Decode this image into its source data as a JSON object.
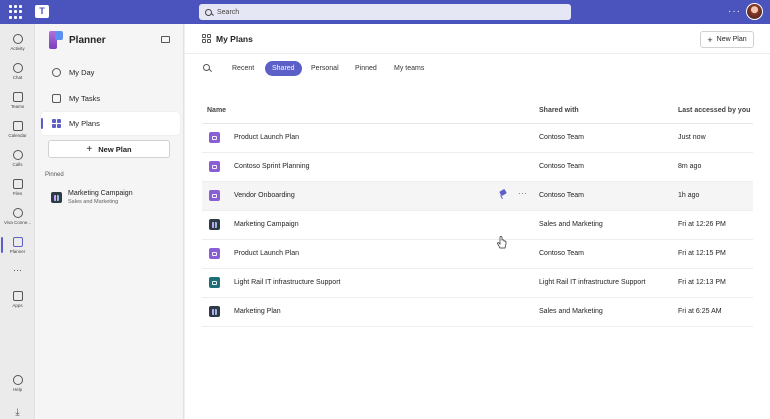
{
  "topbar": {
    "search_placeholder": "Search",
    "more_label": "···",
    "waffle_icon": "waffle-icon",
    "avatar_icon": "user-avatar"
  },
  "rail": {
    "items": [
      {
        "label": "Activity",
        "icon": "bell-icon"
      },
      {
        "label": "Chat",
        "icon": "chat-icon"
      },
      {
        "label": "Teams",
        "icon": "teams-icon"
      },
      {
        "label": "Calendar",
        "icon": "calendar-icon"
      },
      {
        "label": "Calls",
        "icon": "phone-icon"
      },
      {
        "label": "Files",
        "icon": "file-icon"
      },
      {
        "label": "Viva Conne...",
        "icon": "viva-icon"
      },
      {
        "label": "Planner",
        "icon": "planner-icon"
      },
      {
        "label": "···",
        "icon": "more-icon"
      },
      {
        "label": "Apps",
        "icon": "apps-icon"
      },
      {
        "label": "Help",
        "icon": "help-icon"
      },
      {
        "label": "",
        "icon": "download-icon"
      }
    ]
  },
  "sidebar": {
    "app_title": "Planner",
    "nav": [
      {
        "label": "My Day"
      },
      {
        "label": "My Tasks"
      },
      {
        "label": "My Plans"
      }
    ],
    "new_plan_label": "New Plan",
    "pinned_header": "Pinned",
    "pinned": {
      "name": "Marketing Campaign",
      "sub": "Sales and Marketing"
    }
  },
  "main": {
    "title": "My Plans",
    "new_plan_label": "New Plan",
    "tabs": [
      "Recent",
      "Shared",
      "Personal",
      "Pinned",
      "My teams"
    ],
    "active_tab": "Shared",
    "columns": [
      "Name",
      "Shared with",
      "Last accessed by you"
    ],
    "rows": [
      {
        "name": "Product Launch Plan",
        "shared_with": "Contoso Team",
        "last_accessed": "Just now",
        "tile": "purple"
      },
      {
        "name": "Contoso Sprint Planning",
        "shared_with": "Contoso Team",
        "last_accessed": "8m ago",
        "tile": "purple"
      },
      {
        "name": "Vendor Onboarding",
        "shared_with": "Contoso Team",
        "last_accessed": "1h ago",
        "tile": "purple"
      },
      {
        "name": "Marketing Campaign",
        "shared_with": "Sales and Marketing",
        "last_accessed": "Fri at 12:26 PM",
        "tile": "dark"
      },
      {
        "name": "Product Launch Plan",
        "shared_with": "Contoso Team",
        "last_accessed": "Fri at 12:15 PM",
        "tile": "purple"
      },
      {
        "name": "Light Rail IT infrastructure Support",
        "shared_with": "Light Rail IT infrastructure Support",
        "last_accessed": "Fri at 12:13 PM",
        "tile": "teal"
      },
      {
        "name": "Marketing Plan",
        "shared_with": "Sales and Marketing",
        "last_accessed": "Fri at 6:25 AM",
        "tile": "dark"
      }
    ],
    "row_more_label": "···"
  },
  "colors": {
    "brand": "#4b53bc",
    "accent": "#5b5fc7"
  }
}
